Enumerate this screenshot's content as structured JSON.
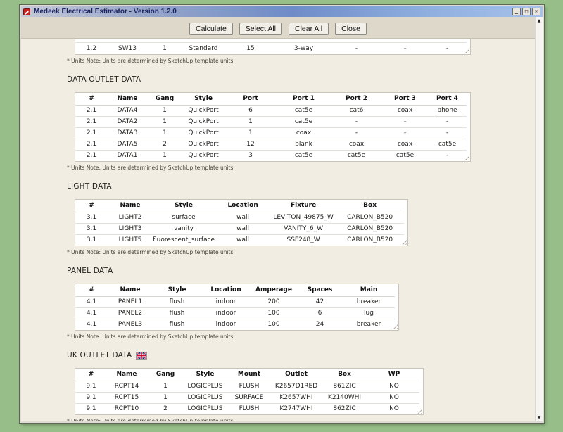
{
  "window": {
    "title": "Medeek Electrical Estimator - Version 1.2.0"
  },
  "window_controls": {
    "minimize": "_",
    "maximize": "□",
    "close": "✕"
  },
  "toolbar": {
    "calculate": "Calculate",
    "select_all": "Select All",
    "clear_all": "Clear All",
    "close": "Close"
  },
  "units_note": "* Units Note: Units are determined by SketchUp template units.",
  "icons": {
    "scroll_up": "▲",
    "scroll_down": "▼",
    "uk_flag": "uk-flag",
    "app": "medeek-sketchup-icon"
  },
  "tables": {
    "switch_partial": {
      "heading": "",
      "columns": [],
      "rows": [
        [
          "1.2",
          "SW13",
          "1",
          "Standard",
          "15",
          "3-way",
          "-",
          "-",
          "-"
        ]
      ]
    },
    "data_outlet": {
      "heading": "DATA OUTLET DATA",
      "columns": [
        "#",
        "Name",
        "Gang",
        "Style",
        "Port",
        "Port 1",
        "Port 2",
        "Port 3",
        "Port 4"
      ],
      "rows": [
        [
          "2.1",
          "DATA4",
          "1",
          "QuickPort",
          "6",
          "cat5e",
          "cat6",
          "coax",
          "phone"
        ],
        [
          "2.1",
          "DATA2",
          "1",
          "QuickPort",
          "1",
          "cat5e",
          "-",
          "-",
          "-"
        ],
        [
          "2.1",
          "DATA3",
          "1",
          "QuickPort",
          "1",
          "coax",
          "-",
          "-",
          "-"
        ],
        [
          "2.1",
          "DATA5",
          "2",
          "QuickPort",
          "12",
          "blank",
          "coax",
          "coax",
          "cat5e"
        ],
        [
          "2.1",
          "DATA1",
          "1",
          "QuickPort",
          "3",
          "cat5e",
          "cat5e",
          "cat5e",
          "-"
        ]
      ]
    },
    "light": {
      "heading": "LIGHT DATA",
      "columns": [
        "#",
        "Name",
        "Style",
        "Location",
        "Fixture",
        "Box"
      ],
      "rows": [
        [
          "3.1",
          "LIGHT2",
          "surface",
          "wall",
          "LEVITON_49875_W",
          "CARLON_B520"
        ],
        [
          "3.1",
          "LIGHT3",
          "vanity",
          "wall",
          "VANITY_6_W",
          "CARLON_B520"
        ],
        [
          "3.1",
          "LIGHT5",
          "fluorescent_surface",
          "wall",
          "SSF248_W",
          "CARLON_B520"
        ]
      ]
    },
    "panel": {
      "heading": "PANEL DATA",
      "columns": [
        "#",
        "Name",
        "Style",
        "Location",
        "Amperage",
        "Spaces",
        "Main"
      ],
      "rows": [
        [
          "4.1",
          "PANEL1",
          "flush",
          "indoor",
          "200",
          "42",
          "breaker"
        ],
        [
          "4.1",
          "PANEL2",
          "flush",
          "indoor",
          "100",
          "6",
          "lug"
        ],
        [
          "4.1",
          "PANEL3",
          "flush",
          "indoor",
          "100",
          "24",
          "breaker"
        ]
      ]
    },
    "uk_outlet": {
      "heading": "UK OUTLET DATA",
      "columns": [
        "#",
        "Name",
        "Gang",
        "Style",
        "Mount",
        "Outlet",
        "Box",
        "WP"
      ],
      "rows": [
        [
          "9.1",
          "RCPT14",
          "1",
          "LOGICPLUS",
          "FLUSH",
          "K2657D1RED",
          "861ZIC",
          "NO"
        ],
        [
          "9.1",
          "RCPT15",
          "1",
          "LOGICPLUS",
          "SURFACE",
          "K2657WHI",
          "K2140WHI",
          "NO"
        ],
        [
          "9.1",
          "RCPT10",
          "2",
          "LOGICPLUS",
          "FLUSH",
          "K2747WHI",
          "862ZIC",
          "NO"
        ]
      ]
    }
  },
  "colors": {
    "desktop_bg": "#97bd88",
    "content_bg": "#f1ede3",
    "toolbar_bg": "#ddd8c9",
    "titlebar_from": "#c6cad6",
    "titlebar_mid": "#6f8cc8",
    "titlebar_to": "#a6c2ea",
    "title_text": "#1c2563",
    "table_border": "#c8c5bb",
    "row_line": "#e4e2da"
  }
}
